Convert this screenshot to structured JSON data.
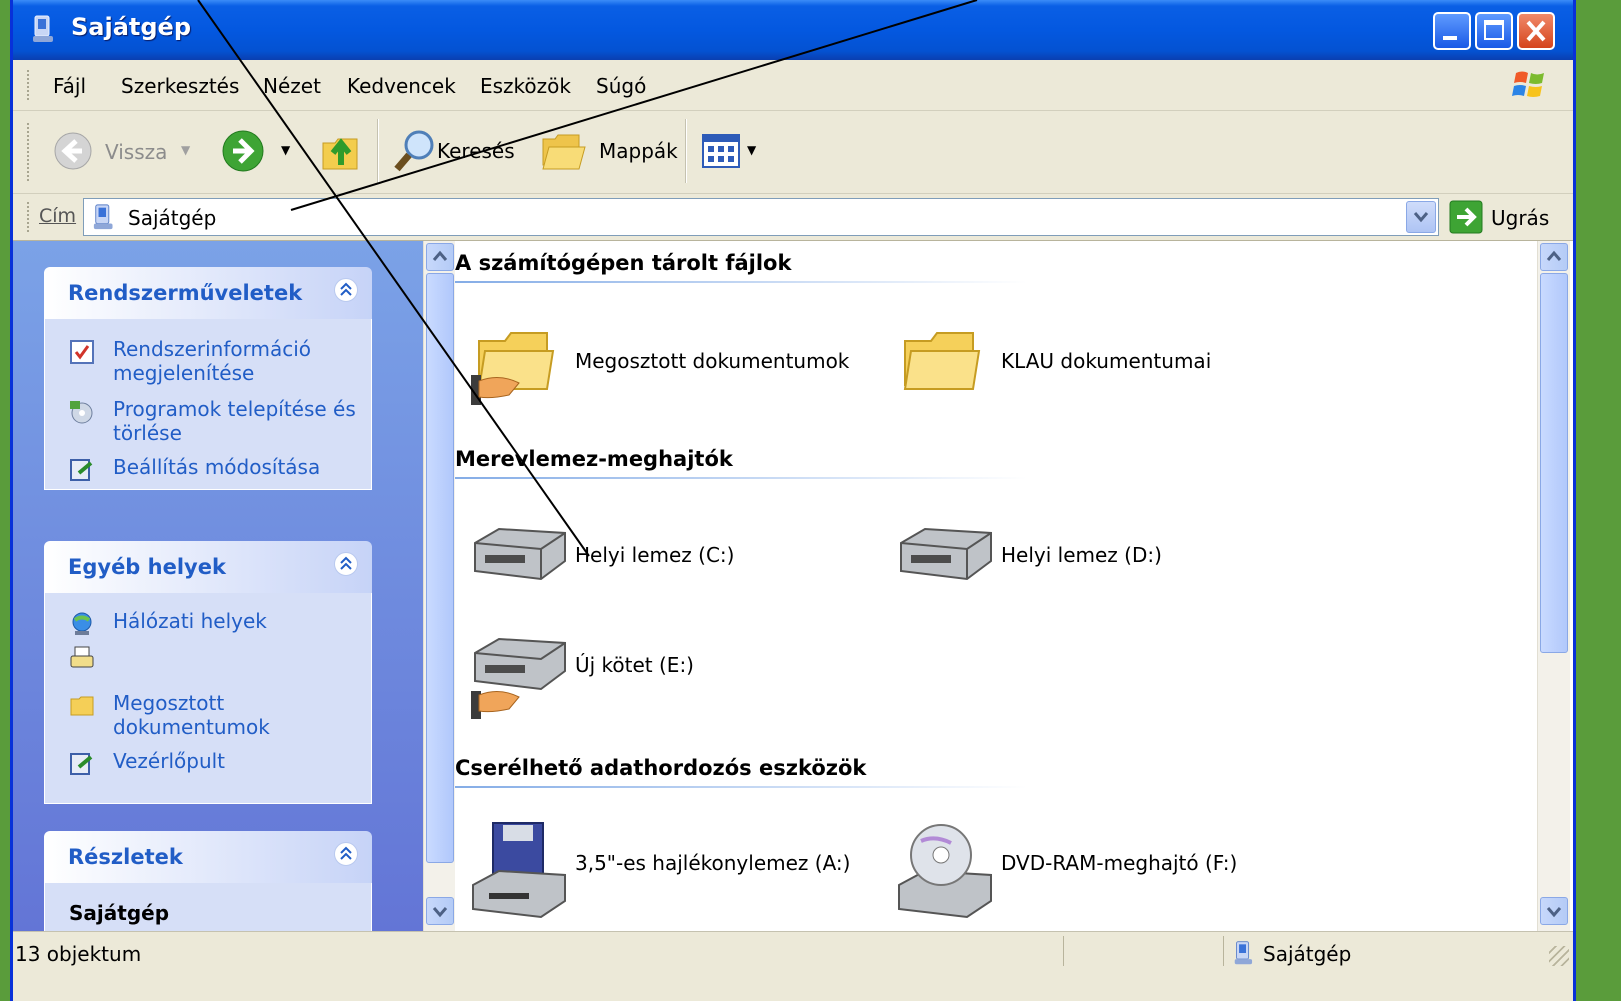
{
  "window": {
    "title": "Sajátgép"
  },
  "menu": {
    "items": [
      {
        "label": "Fájl"
      },
      {
        "label": "Szerkesztés"
      },
      {
        "label": "Nézet"
      },
      {
        "label": "Kedvencek"
      },
      {
        "label": "Eszközök"
      },
      {
        "label": "Súgó"
      }
    ]
  },
  "toolbar": {
    "back_label": "Vissza",
    "search_label": "Keresés",
    "folders_label": "Mappák"
  },
  "address": {
    "label": "Cím",
    "value": "Sajátgép",
    "go_label": "Ugrás"
  },
  "sidebar": {
    "system_tasks": {
      "title": "Rendszerműveletek",
      "items": [
        {
          "label": "Rendszerinformáció megjelenítése"
        },
        {
          "label": "Programok telepítése és törlése"
        },
        {
          "label": "Beállítás módosítása"
        }
      ]
    },
    "other_places": {
      "title": "Egyéb helyek",
      "items": [
        {
          "label": "Hálózati helyek"
        },
        {
          "label": ""
        },
        {
          "label": "Megosztott dokumentumok"
        },
        {
          "label": "Vezérlőpult"
        }
      ]
    },
    "details": {
      "title": "Részletek",
      "name": "Sajátgép"
    }
  },
  "groups": {
    "stored_files": {
      "title": "A számítógépen tárolt fájlok",
      "items": [
        {
          "label": "Megosztott dokumentumok"
        },
        {
          "label": "KLAU dokumentumai"
        }
      ]
    },
    "hard_drives": {
      "title": "Merevlemez-meghajtók",
      "items": [
        {
          "label": "Helyi lemez (C:)"
        },
        {
          "label": "Helyi lemez (D:)"
        },
        {
          "label": "Új kötet (E:)"
        }
      ]
    },
    "removable": {
      "title": "Cserélhető adathordozós eszközök",
      "items": [
        {
          "label": "3,5\"-es hajlékonylemez (A:)"
        },
        {
          "label": "DVD-RAM-meghajtó (F:)"
        }
      ]
    }
  },
  "status": {
    "count": "13 objektum",
    "location": "Sajátgép"
  },
  "colors": {
    "titlebar": "#0458e0",
    "taskpane_link": "#215dc6",
    "background": "#5a9c3b"
  }
}
